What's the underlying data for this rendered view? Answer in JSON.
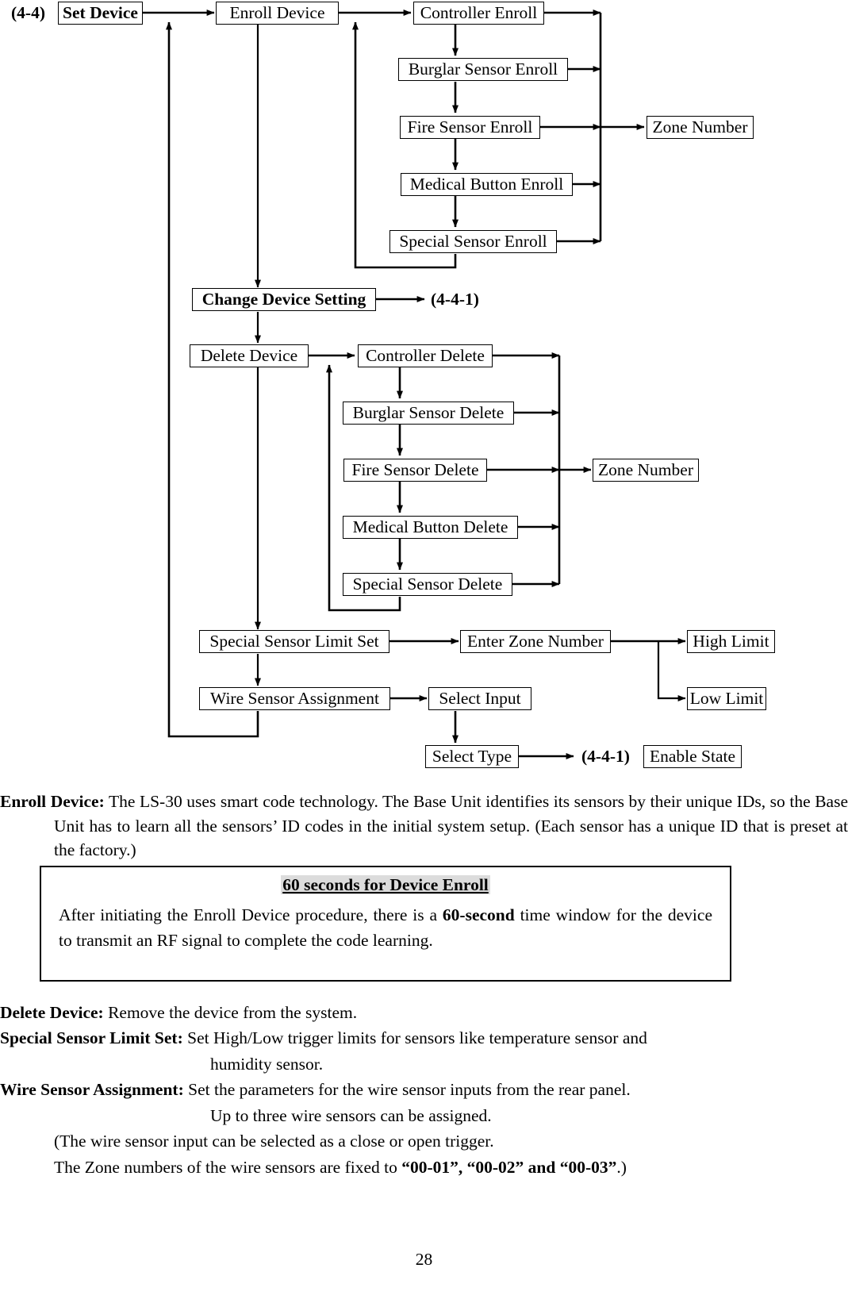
{
  "diagram": {
    "section_label": "(4-4)",
    "nodes": {
      "set_device": "Set Device",
      "enroll_device": "Enroll Device",
      "controller_enroll": "Controller Enroll",
      "burglar_sensor_enroll": "Burglar Sensor Enroll",
      "fire_sensor_enroll": "Fire Sensor Enroll",
      "medical_button_enroll": "Medical Button Enroll",
      "special_sensor_enroll": "Special Sensor Enroll",
      "zone_number_enroll": "Zone Number",
      "change_device_setting": "Change Device Setting",
      "ref_change_device_setting": "(4-4-1)",
      "delete_device": "Delete Device",
      "controller_delete": "Controller Delete",
      "burglar_sensor_delete": "Burglar Sensor Delete",
      "fire_sensor_delete": "Fire Sensor Delete",
      "medical_button_delete": "Medical Button Delete",
      "special_sensor_delete": "Special Sensor Delete",
      "zone_number_delete": "Zone Number",
      "special_sensor_limit_set": "Special Sensor Limit Set",
      "enter_zone_number": "Enter Zone Number",
      "high_limit": "High Limit",
      "low_limit": "Low Limit",
      "wire_sensor_assignment": "Wire Sensor Assignment",
      "select_input": "Select Input",
      "select_type": "Select Type",
      "ref_select_type": "(4-4-1)",
      "enable_state": "Enable State"
    }
  },
  "prose": {
    "enroll": {
      "term": "Enroll Device:",
      "body": " The LS-30 uses smart code technology. The Base Unit identifies its sensors by their unique IDs, so the Base Unit has to learn all the sensors’ ID codes in the initial system setup. (Each sensor has a unique ID that is preset at the factory.)"
    },
    "note": {
      "title": "60 seconds for Device Enroll",
      "body_1": "After initiating the Enroll Device procedure, there is a ",
      "body_bold": "60-second",
      "body_2": " time window for the device to transmit an RF signal to complete the code learning."
    },
    "delete": {
      "term": "Delete Device:",
      "body": " Remove the device from the system."
    },
    "limit": {
      "term": "Special Sensor Limit Set:",
      "body": " Set High/Low trigger limits for sensors like temperature sensor and",
      "body_cont": "humidity sensor."
    },
    "wire": {
      "term": "Wire Sensor Assignment:",
      "body": " Set the parameters for the wire sensor inputs from the rear panel.",
      "body_cont": "Up to three wire sensors can be assigned.",
      "note_1": "(The wire sensor input can be selected as a close or open trigger.",
      "note_2_pre": "The Zone numbers of the wire sensors are fixed to ",
      "note_2_bold": "“00-01”, “00-02” and “00-03”",
      "note_2_post": ".)"
    }
  },
  "page_number": "28"
}
